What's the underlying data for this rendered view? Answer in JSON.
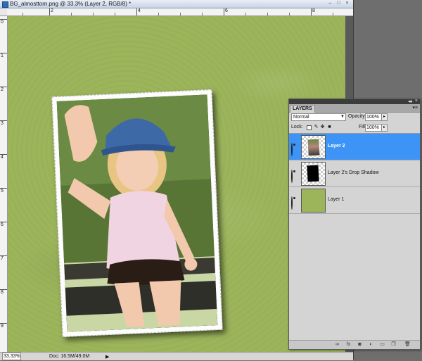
{
  "window": {
    "title": "BG_almosttorn.png @ 33.3% (Layer 2, RGB/8) *",
    "buttons": [
      "–",
      "□",
      "×"
    ]
  },
  "ruler": {
    "top_labels": [
      "2",
      "4",
      "6",
      "8"
    ],
    "left_labels": [
      "0",
      "1",
      "2",
      "3",
      "4",
      "5",
      "6",
      "7",
      "8",
      "9"
    ]
  },
  "status": {
    "zoom": "33.33%",
    "doc_info": "Doc: 16.5M/49.0M",
    "arrow": "▶"
  },
  "layers_panel": {
    "tab": "LAYERS",
    "collapse": "◂◂",
    "close": "×",
    "menu": "▾≡",
    "blend_mode": "Normal",
    "opacity_label": "Opacity:",
    "opacity_value": "100%",
    "lock_label": "Lock:",
    "fill_label": "Fill:",
    "fill_value": "100%",
    "layers": [
      {
        "name": "Layer 2",
        "selected": true,
        "thumb": "photo-icon"
      },
      {
        "name": "Layer 2's Drop Shadow",
        "selected": false,
        "thumb": "shadow-icon"
      },
      {
        "name": "Layer 1",
        "selected": false,
        "thumb": "green-fill-icon"
      }
    ],
    "bottom_icons": [
      "link-icon",
      "fx-icon",
      "mask-icon",
      "adjustment-icon",
      "group-icon",
      "new-layer-icon",
      "trash-icon"
    ]
  },
  "colors": {
    "canvas_green": "#9cb55b",
    "selection_blue": "#3d94f6",
    "panel_gray": "#d4d4d4"
  }
}
